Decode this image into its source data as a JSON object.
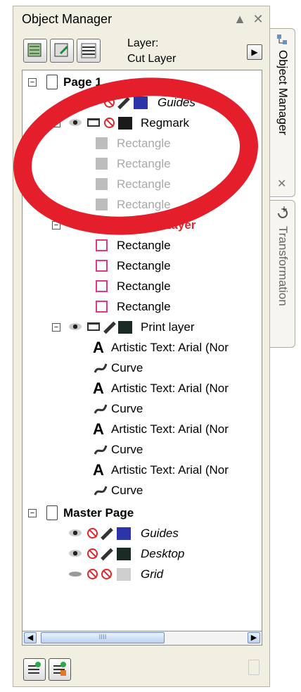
{
  "panel": {
    "title": "Object Manager",
    "layer_label_line1": "Layer:",
    "layer_label_line2": "Cut Layer",
    "title_controls": [
      "▲",
      "✕"
    ]
  },
  "tree": {
    "page1": {
      "label": "Page 1",
      "guides_label": "Guides",
      "regmark": {
        "label": "Regmark",
        "children": [
          "Rectangle",
          "Rectangle",
          "Rectangle",
          "Rectangle"
        ]
      },
      "cut_layer": {
        "label": "Cut Layer",
        "children": [
          "Rectangle",
          "Rectangle",
          "Rectangle",
          "Rectangle"
        ]
      },
      "print_layer": {
        "label": "Print layer",
        "children": [
          {
            "type": "text",
            "label": "Artistic Text: Arial (Nor"
          },
          {
            "type": "curve",
            "label": "Curve"
          },
          {
            "type": "text",
            "label": "Artistic Text: Arial (Nor"
          },
          {
            "type": "curve",
            "label": "Curve"
          },
          {
            "type": "text",
            "label": "Artistic Text: Arial (Nor"
          },
          {
            "type": "curve",
            "label": "Curve"
          },
          {
            "type": "text",
            "label": "Artistic Text: Arial (Nor"
          },
          {
            "type": "curve",
            "label": "Curve"
          }
        ]
      }
    },
    "master_page": {
      "label": "Master Page",
      "layers": [
        "Guides",
        "Desktop",
        "Grid"
      ]
    }
  },
  "scrollbar": {
    "thumb_grip": "IIII"
  },
  "side_tabs": {
    "object_manager": "Object Manager",
    "transformation": "Transformation",
    "close": "✕"
  },
  "colors": {
    "annotation_red": "#e41e2b",
    "guides_blue": "#2b35a8",
    "cut_layer_red": "#e0252b",
    "rect_pink": "#e03a86"
  }
}
